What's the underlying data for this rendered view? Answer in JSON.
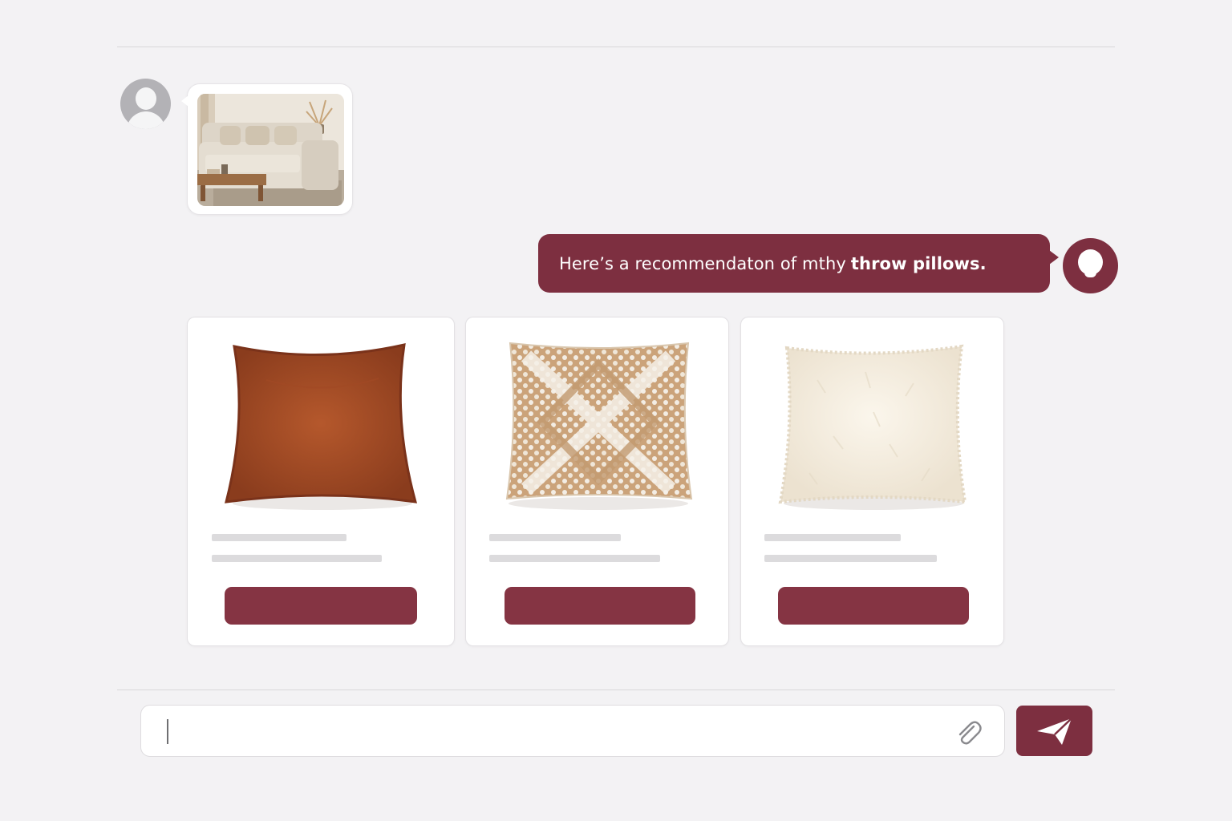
{
  "colors": {
    "accent": "#7d2f40",
    "button": "#853443",
    "background": "#f3f2f4",
    "skeleton": "#dcdbdd"
  },
  "chat": {
    "user_message": {
      "avatar_icon": "user-avatar-icon",
      "attachment": "room-photo"
    },
    "assistant_message": {
      "text_regular": "Here’s a recommendaton of mthy",
      "text_bold": "throw pillows.",
      "avatar_icon": "assistant-avatar-icon"
    }
  },
  "products": [
    {
      "image": "rust-velvet-pillow"
    },
    {
      "image": "geometric-woven-pillow"
    },
    {
      "image": "cream-shag-pillow"
    }
  ],
  "composer": {
    "value": "",
    "attach_icon": "paperclip-icon",
    "send_icon": "send-icon"
  }
}
